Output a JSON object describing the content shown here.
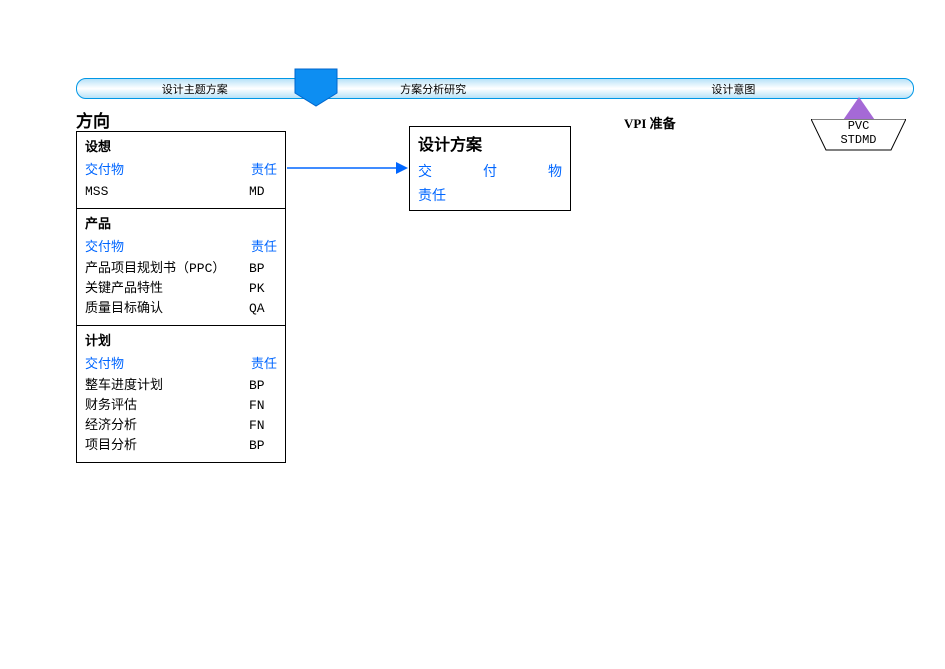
{
  "timeline": {
    "seg1": "设计主题方案",
    "seg2": "方案分析研究",
    "seg3": "设计意图"
  },
  "milestone": {
    "line1": "PVC",
    "line2": "STDMD"
  },
  "labels": {
    "direction": "方向",
    "vpi": "VPI 准备"
  },
  "design_panel": {
    "title": "设计方案",
    "cell1": "交",
    "cell2": "付",
    "cell3": "物",
    "row2": "责任"
  },
  "panels": [
    {
      "title": "设想",
      "header_left": "交付物",
      "header_right": "责任",
      "rows": [
        {
          "deliv": "MSS",
          "resp": "MD"
        }
      ]
    },
    {
      "title": "产品",
      "header_left": "交付物",
      "header_right": "责任",
      "rows": [
        {
          "deliv": "产品项目规划书（PPC）",
          "resp": "BP"
        },
        {
          "deliv": "关键产品特性",
          "resp": "PK"
        },
        {
          "deliv": "质量目标确认",
          "resp": "QA"
        }
      ]
    },
    {
      "title": "计划",
      "header_left": "交付物",
      "header_right": "责任",
      "rows": [
        {
          "deliv": "整车进度计划",
          "resp": "BP"
        },
        {
          "deliv": "财务评估",
          "resp": "FN"
        },
        {
          "deliv": "经济分析",
          "resp": "FN"
        },
        {
          "deliv": "项目分析",
          "resp": "BP"
        }
      ]
    }
  ]
}
